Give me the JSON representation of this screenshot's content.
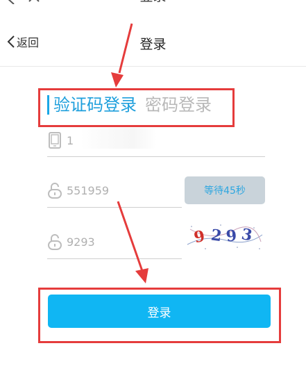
{
  "top_bar": {
    "title": "登录"
  },
  "header": {
    "back_label": "返回",
    "title": "登录"
  },
  "tabs": [
    {
      "label": "验证码登录",
      "active": true
    },
    {
      "label": "密码登录",
      "active": false
    }
  ],
  "phone_field": {
    "value": "1",
    "icon": "phone-icon"
  },
  "sms_code_field": {
    "value": "551959",
    "icon": "lock-icon"
  },
  "wait_button": {
    "label": "等待45秒"
  },
  "captcha_field": {
    "value": "9293",
    "icon": "lock-icon"
  },
  "captcha_image": {
    "text": "9293"
  },
  "login_button": {
    "label": "登录"
  },
  "colors": {
    "accent": "#1e9fdc",
    "button": "#10b6f3",
    "annotation": "#e53c3c"
  }
}
